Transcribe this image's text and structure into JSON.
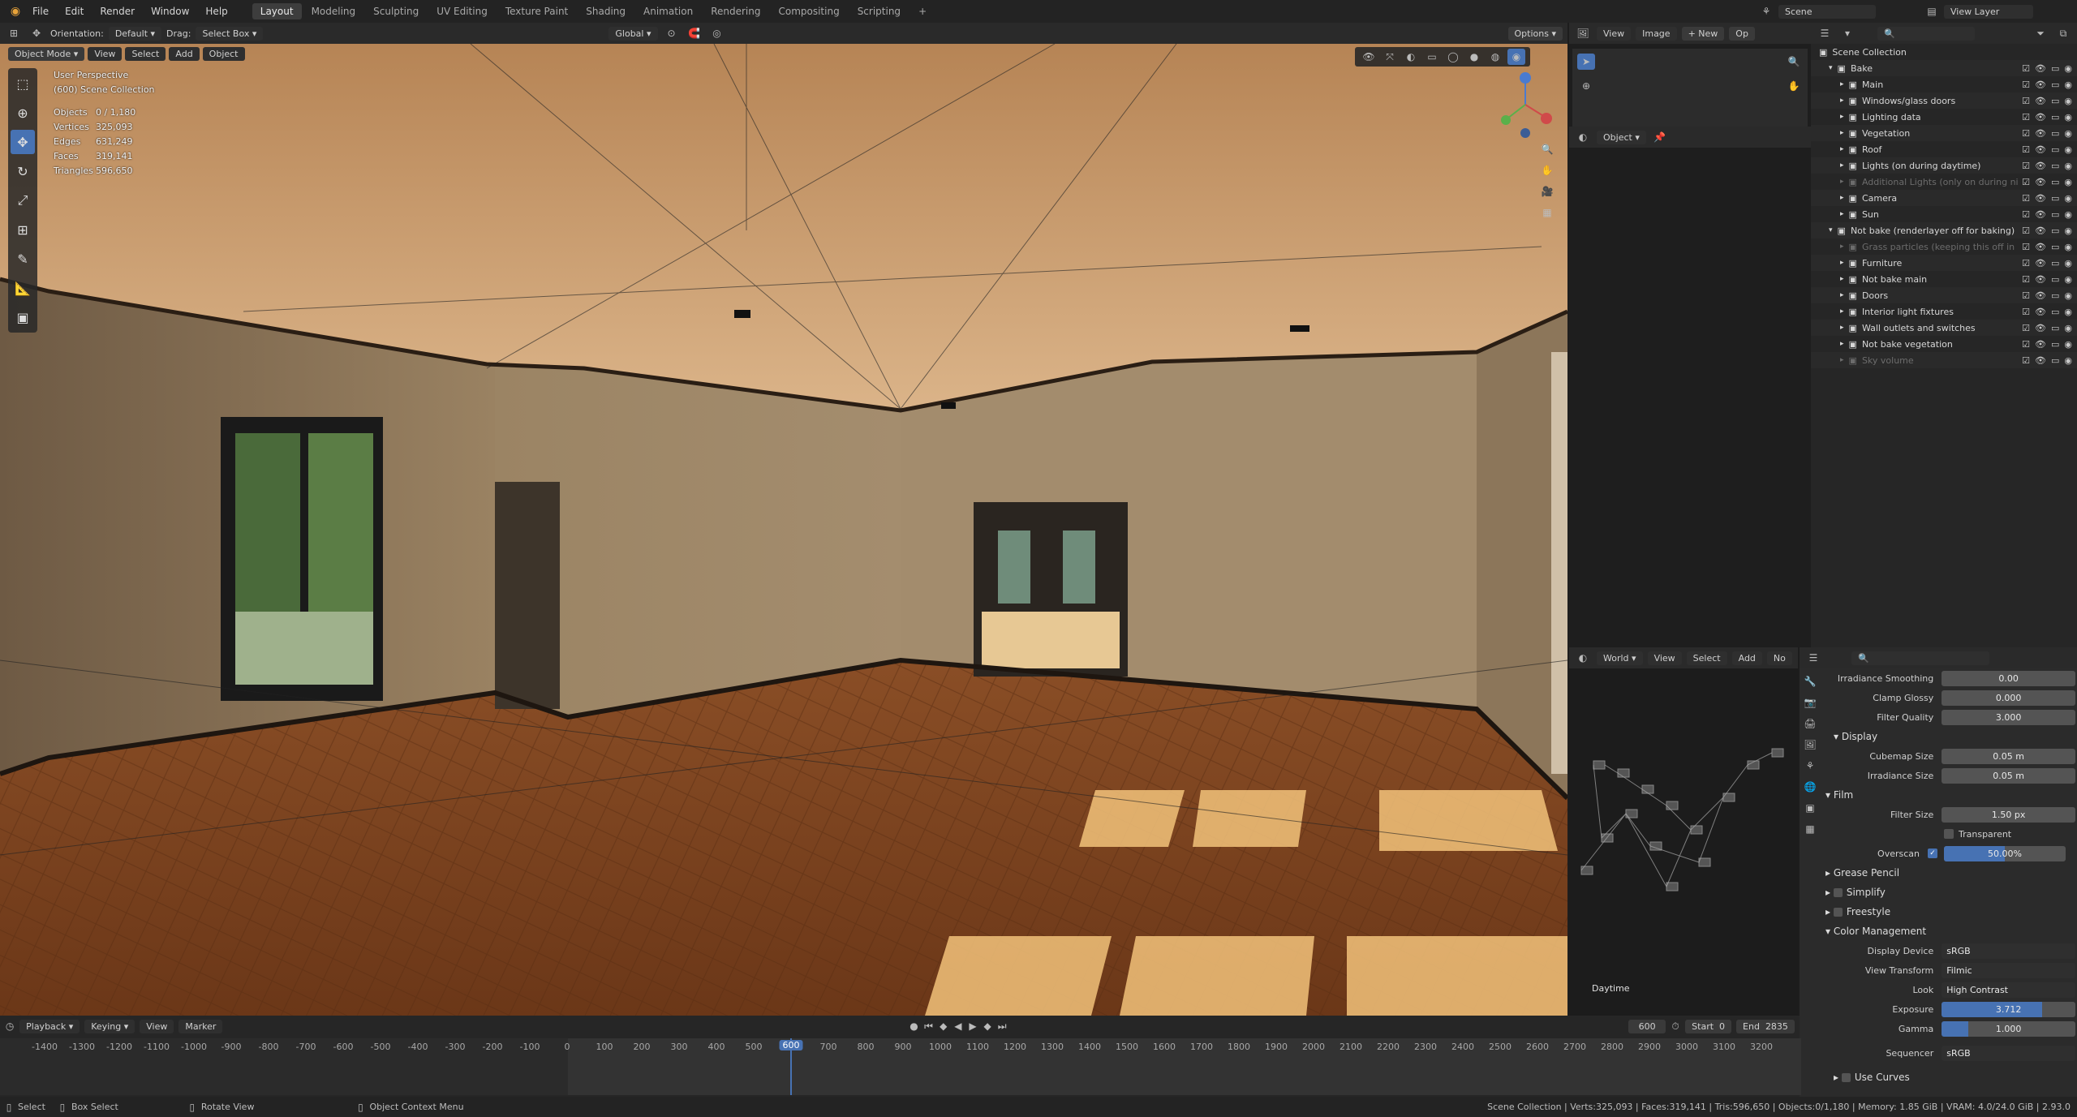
{
  "topbar": {
    "menus": [
      "File",
      "Edit",
      "Render",
      "Window",
      "Help"
    ],
    "workspaces": [
      "Layout",
      "Modeling",
      "Sculpting",
      "UV Editing",
      "Texture Paint",
      "Shading",
      "Animation",
      "Rendering",
      "Compositing",
      "Scripting"
    ],
    "active_workspace": "Layout",
    "add_tab": "+",
    "scene_label": "Scene",
    "view_layer_label": "View Layer"
  },
  "viewport_header": {
    "orientation_label": "Orientation:",
    "orientation_value": "Default",
    "drag_label": "Drag:",
    "drag_value": "Select Box",
    "transform_value": "Global",
    "options_label": "Options",
    "mode": "Object Mode",
    "menus": [
      "View",
      "Select",
      "Add",
      "Object"
    ]
  },
  "viewport_stats": {
    "perspective": "User Perspective",
    "collection": "(600) Scene Collection",
    "rows": [
      {
        "label": "Objects",
        "value": "0 / 1,180"
      },
      {
        "label": "Vertices",
        "value": "325,093"
      },
      {
        "label": "Edges",
        "value": "631,249"
      },
      {
        "label": "Faces",
        "value": "319,141"
      },
      {
        "label": "Triangles",
        "value": "596,650"
      }
    ]
  },
  "image_editor": {
    "menus": [
      "View",
      "Image"
    ],
    "new_label": "New",
    "open_label": "Op",
    "object_label": "Object"
  },
  "outliner": {
    "title": "Scene Collection",
    "rows": [
      {
        "label": "Bake",
        "level": 1,
        "dim": false
      },
      {
        "label": "Main",
        "level": 2,
        "dim": false
      },
      {
        "label": "Windows/glass doors",
        "level": 2,
        "dim": false
      },
      {
        "label": "Lighting data",
        "level": 2,
        "dim": false
      },
      {
        "label": "Vegetation",
        "level": 2,
        "dim": false
      },
      {
        "label": "Roof",
        "level": 2,
        "dim": false
      },
      {
        "label": "Lights (on during daytime)",
        "level": 2,
        "dim": false
      },
      {
        "label": "Additional Lights (only on during ni",
        "level": 2,
        "dim": true
      },
      {
        "label": "Camera",
        "level": 2,
        "dim": false
      },
      {
        "label": "Sun",
        "level": 2,
        "dim": false
      },
      {
        "label": "Not bake (renderlayer off for baking)",
        "level": 1,
        "dim": false
      },
      {
        "label": "Grass particles (keeping this off in",
        "level": 2,
        "dim": true
      },
      {
        "label": "Furniture",
        "level": 2,
        "dim": false
      },
      {
        "label": "Not bake main",
        "level": 2,
        "dim": false
      },
      {
        "label": "Doors",
        "level": 2,
        "dim": false
      },
      {
        "label": "Interior light fixtures",
        "level": 2,
        "dim": false
      },
      {
        "label": "Wall outlets and switches",
        "level": 2,
        "dim": false
      },
      {
        "label": "Not bake vegetation",
        "level": 2,
        "dim": false
      },
      {
        "label": "Sky volume",
        "level": 2,
        "dim": true
      }
    ]
  },
  "node_editor": {
    "world_label": "World",
    "menus": [
      "View",
      "Select",
      "Add",
      "No"
    ],
    "daytime_label": "Daytime"
  },
  "properties": {
    "rows_top": [
      {
        "label": "Irradiance Smoothing",
        "value": "0.00"
      },
      {
        "label": "Clamp Glossy",
        "value": "0.000"
      },
      {
        "label": "Filter Quality",
        "value": "3.000"
      }
    ],
    "display_panel": "Display",
    "display_rows": [
      {
        "label": "Cubemap Size",
        "value": "0.05 m"
      },
      {
        "label": "Irradiance Size",
        "value": "0.05 m"
      }
    ],
    "film_panel": "Film",
    "filter_size_label": "Filter Size",
    "filter_size_value": "1.50 px",
    "transparent_label": "Transparent",
    "overscan_label": "Overscan",
    "overscan_value": "50.00%",
    "overscan_fraction": 0.5,
    "collapsed_panels": [
      "Grease Pencil",
      "Simplify",
      "Freestyle"
    ],
    "color_panel": "Color Management",
    "color_rows": [
      {
        "label": "Display Device",
        "value": "sRGB"
      },
      {
        "label": "View Transform",
        "value": "Filmic"
      },
      {
        "label": "Look",
        "value": "High Contrast"
      }
    ],
    "exposure_label": "Exposure",
    "exposure_value": "3.712",
    "gamma_label": "Gamma",
    "gamma_value": "1.000",
    "sequencer_label": "Sequencer",
    "sequencer_value": "sRGB",
    "use_curves_label": "Use Curves"
  },
  "timeline": {
    "menus": [
      "Playback",
      "Keying",
      "View",
      "Marker"
    ],
    "current_frame": "600",
    "start_label": "Start",
    "start_value": "0",
    "end_label": "End",
    "end_value": "2835",
    "ticks": [
      "-1400",
      "-1300",
      "-1200",
      "-1100",
      "-1000",
      "-900",
      "-800",
      "-700",
      "-600",
      "-500",
      "-400",
      "-300",
      "-200",
      "-100",
      "0",
      "100",
      "200",
      "300",
      "400",
      "500",
      "600",
      "700",
      "800",
      "900",
      "1000",
      "1100",
      "1200",
      "1300",
      "1400",
      "1500",
      "1600",
      "1700",
      "1800",
      "1900",
      "2000",
      "2100",
      "2200",
      "2300",
      "2400",
      "2500",
      "2600",
      "2700",
      "2800",
      "2900",
      "3000",
      "3100",
      "3200"
    ]
  },
  "statusbar": {
    "select": "Select",
    "box_select": "Box Select",
    "rotate_view": "Rotate View",
    "context_menu": "Object Context Menu",
    "info": "Scene Collection | Verts:325,093 | Faces:319,141 | Tris:596,650 | Objects:0/1,180 | Memory: 1.85 GiB | VRAM: 4.0/24.0 GiB | 2.93.0"
  },
  "colors": {
    "accent": "#4772b3",
    "orange_icon": "#e8a33a"
  }
}
